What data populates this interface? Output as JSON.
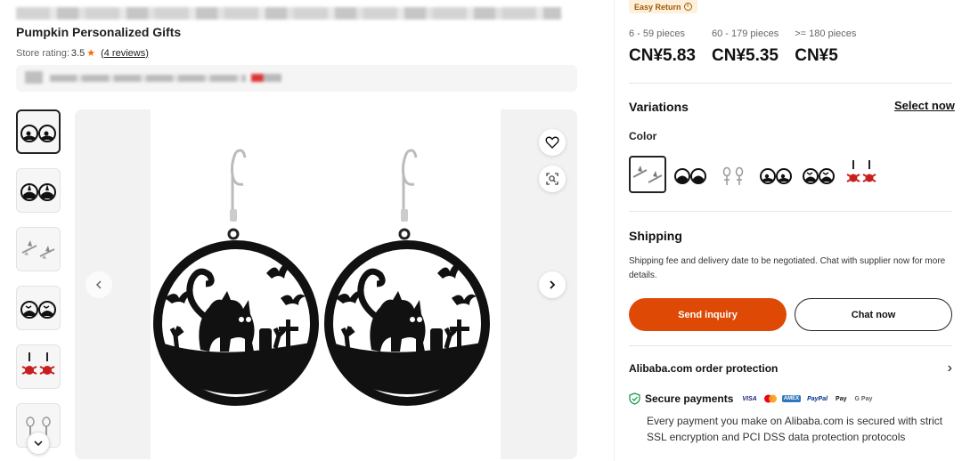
{
  "store": {
    "name": "Pumpkin Personalized Gifts",
    "rating_label": "Store rating:",
    "rating_value": "3.5",
    "reviews_text": "(4 reviews)"
  },
  "gallery": {
    "thumbnails": [
      {
        "variant": "cat-graveyard",
        "active": true
      },
      {
        "variant": "witch-pumpkin"
      },
      {
        "variant": "witch-broom"
      },
      {
        "variant": "cat-bats"
      },
      {
        "variant": "red-spider"
      },
      {
        "variant": "skeleton"
      }
    ],
    "main_image": "black cat graveyard earrings"
  },
  "pricing": {
    "badge": "Easy Return",
    "tiers": [
      {
        "qty": "6 - 59 pieces",
        "price": "CN¥5.83"
      },
      {
        "qty": "60 - 179 pieces",
        "price": "CN¥5.35"
      },
      {
        "qty": ">= 180 pieces",
        "price": "CN¥5"
      }
    ]
  },
  "variations": {
    "title": "Variations",
    "select_now": "Select now",
    "color_label": "Color",
    "options": [
      "witch-broom",
      "witch-pumpkin",
      "skeleton",
      "cat-graveyard",
      "cat-bats",
      "red-spider"
    ]
  },
  "shipping": {
    "title": "Shipping",
    "text": "Shipping fee and delivery date to be negotiated. Chat with supplier now for more details."
  },
  "actions": {
    "inquiry": "Send inquiry",
    "chat": "Chat now"
  },
  "protection": {
    "title": "Alibaba.com order protection",
    "secure_title": "Secure payments",
    "payment_logos": [
      "VISA",
      "MC",
      "AMEX",
      "PayPal",
      "Pay",
      "G Pay"
    ],
    "secure_desc": "Every payment you make on Alibaba.com is secured with strict SSL encryption and PCI DSS data protection protocols"
  },
  "colors": {
    "accent": "#de4a06",
    "star": "#ff6a00",
    "badge_bg": "#fdf1dd",
    "badge_text": "#a15a00",
    "secure_green": "#1a9b4b"
  }
}
